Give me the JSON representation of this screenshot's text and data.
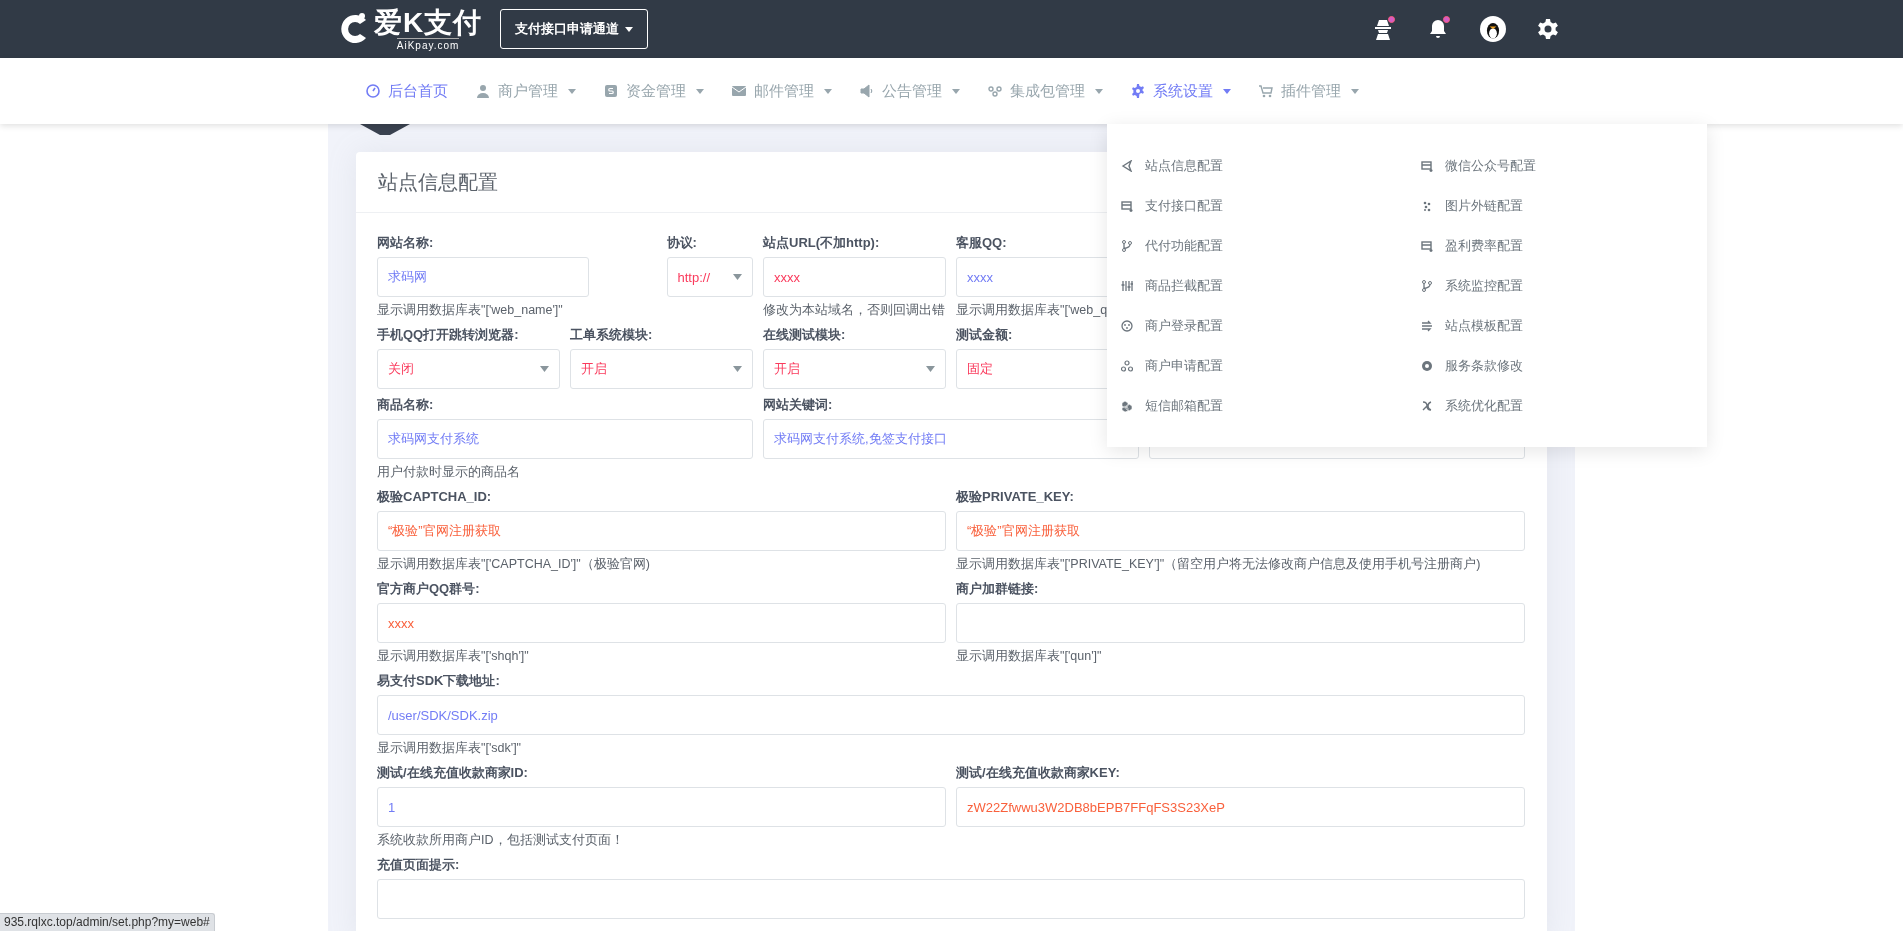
{
  "header": {
    "logo": {
      "title": "爱K支付",
      "subtitle": "AiKpay.com"
    },
    "apply_button": {
      "label": "支付接口申请通道"
    },
    "icons": [
      {
        "kind": "user-secret",
        "dot": true
      },
      {
        "kind": "bell",
        "dot": true
      },
      {
        "kind": "avatar",
        "dot": false
      },
      {
        "kind": "gear",
        "dot": false
      }
    ]
  },
  "nav": {
    "items": [
      {
        "label": "后台首页",
        "selected": true,
        "has_menu": false
      },
      {
        "label": "商户管理",
        "selected": false,
        "has_menu": true
      },
      {
        "label": "资金管理",
        "selected": false,
        "has_menu": true
      },
      {
        "label": "邮件管理",
        "selected": false,
        "has_menu": true
      },
      {
        "label": "公告管理",
        "selected": false,
        "has_menu": true
      },
      {
        "label": "集成包管理",
        "selected": false,
        "has_menu": true
      },
      {
        "label": "系统设置",
        "selected": true,
        "has_menu": true
      },
      {
        "label": "插件管理",
        "selected": false,
        "has_menu": true
      }
    ]
  },
  "menu": {
    "items": [
      {
        "label": "站点信息配置"
      },
      {
        "label": "微信公众号配置"
      },
      {
        "label": "支付接口配置"
      },
      {
        "label": "图片外链配置"
      },
      {
        "label": "代付功能配置"
      },
      {
        "label": "盈利费率配置"
      },
      {
        "label": "商品拦截配置"
      },
      {
        "label": "系统监控配置"
      },
      {
        "label": "商户登录配置"
      },
      {
        "label": "站点模板配置"
      },
      {
        "label": "商户申请配置"
      },
      {
        "label": "服务条款修改"
      },
      {
        "label": "短信邮箱配置"
      },
      {
        "label": "系统优化配置"
      }
    ]
  },
  "card": {
    "title": "站点信息配置",
    "fields": [
      {
        "kind": "input",
        "label": "网站名称:",
        "value": "求码网",
        "color": "#727cf5",
        "hint": "显示调用数据库表\"['web_name']\""
      },
      {
        "kind": "select",
        "label": "协议:",
        "value": "http://",
        "color": "#fa3a5c"
      },
      {
        "kind": "input",
        "label": "站点URL(不加http):",
        "value": "xxxx",
        "color": "#fa3a5c",
        "hint": "修改为本站域名，否则回调出错"
      },
      {
        "kind": "input",
        "label": "客服QQ:",
        "value": "xxxx",
        "color": "#727cf5",
        "hint": "显示调用数据库表\"['web_q"
      },
      {
        "kind": "select",
        "label": "手机QQ打开跳转浏览器:",
        "value": "关闭",
        "color": "#fa3a5c"
      },
      {
        "kind": "select",
        "label": "工单系统模块:",
        "value": "开启",
        "color": "#fa3a5c"
      },
      {
        "kind": "select",
        "label": "在线测试模块:",
        "value": "开启",
        "color": "#fa3a5c"
      },
      {
        "kind": "input",
        "label": "测试金额:",
        "value": "固定",
        "color": "#fa3a5c"
      },
      {
        "kind": "input",
        "label": "商品名称:",
        "value": "求码网支付系统",
        "color": "#727cf5",
        "hint": "用户付款时显示的商品名"
      },
      {
        "kind": "input",
        "label": "网站关键词:",
        "value": "求码网支付系统,免签支付接口",
        "color": "#727cf5"
      },
      {
        "kind": "input"
      },
      {
        "kind": "input",
        "label": "极验CAPTCHA_ID:",
        "value": "“极验”官网注册获取",
        "color": "#f9603c",
        "hint": "显示调用数据库表\"['CAPTCHA_ID']\"（极验官网)"
      },
      {
        "kind": "input",
        "label": "极验PRIVATE_KEY:",
        "value": "“极验”官网注册获取",
        "color": "#f9603c",
        "hint": "显示调用数据库表\"['PRIVATE_KEY']\"（留空用户将无法修改商户信息及使用手机号注册商户)"
      },
      {
        "kind": "input",
        "label": "官方商户QQ群号:",
        "value": "xxxx",
        "color": "#f9603c",
        "hint": "显示调用数据库表\"['shqh']\""
      },
      {
        "kind": "input",
        "label": "商户加群链接:",
        "hint": "显示调用数据库表\"['qun']\""
      },
      {
        "kind": "input",
        "label": "易支付SDK下载地址:",
        "value": "/user/SDK/SDK.zip",
        "color": "#727cf5",
        "hint": "显示调用数据库表\"['sdk']\""
      },
      {
        "kind": "input",
        "label": "测试/在线充值收款商家ID:",
        "value": "1",
        "color": "#727cf5",
        "hint": "系统收款所用商户ID，包括测试支付页面！"
      },
      {
        "kind": "input",
        "label": "测试/在线充值收款商家KEY:",
        "value": "zW22Zfwwu3W2DB8bEPB7FFqFS3S23XeP",
        "color": "#f9603c"
      },
      {
        "kind": "input",
        "label": "充值页面提示:"
      }
    ]
  },
  "status_bar": {
    "url": "935.rqlxc.top/admin/set.php?my=web#"
  }
}
